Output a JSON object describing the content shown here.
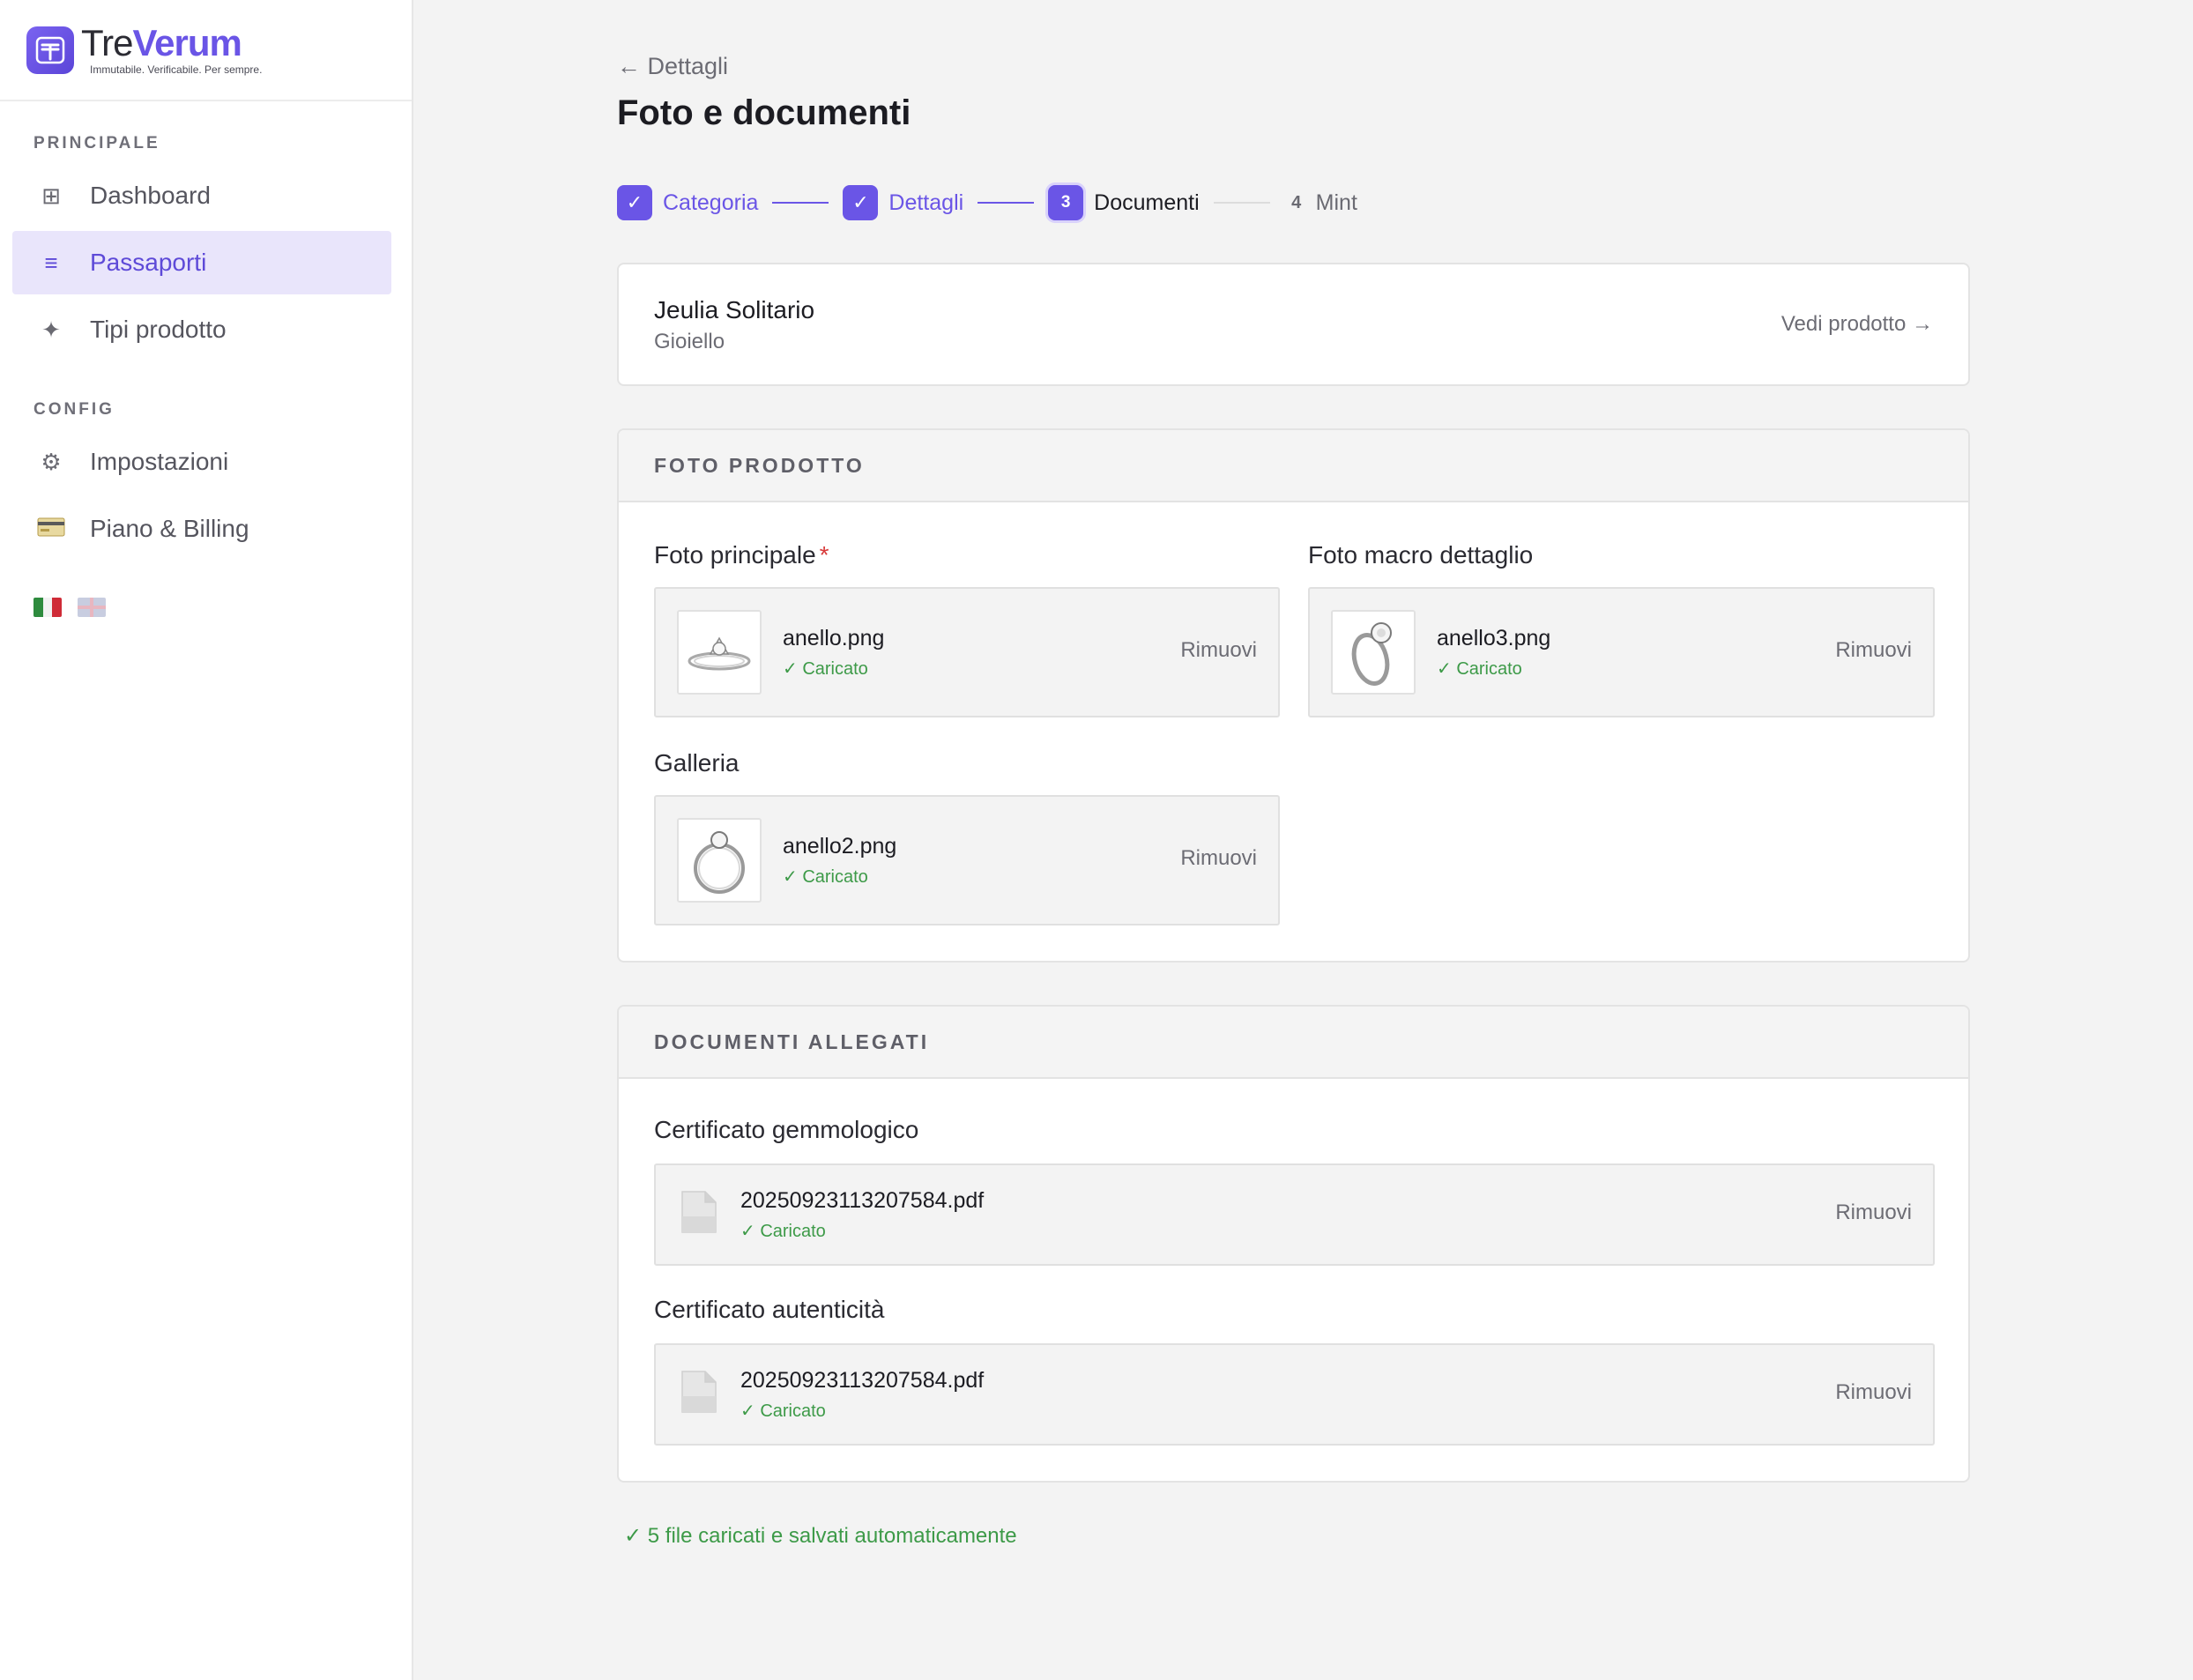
{
  "brand": {
    "name_part1": "Tre",
    "name_part2": "Verum",
    "tagline": "Immutabile. Verificabile. Per sempre.",
    "accent_color": "#6a55e6"
  },
  "sidebar": {
    "section_main": "PRINCIPALE",
    "section_config": "CONFIG",
    "items": [
      {
        "label": "Dashboard",
        "icon": "grid-icon",
        "active": false
      },
      {
        "label": "Passaporti",
        "icon": "list-icon",
        "active": true
      },
      {
        "label": "Tipi prodotto",
        "icon": "sparkle-icon",
        "active": false
      },
      {
        "label": "Impostazioni",
        "icon": "gear-icon",
        "active": false
      },
      {
        "label": "Piano & Billing",
        "icon": "credit-card-icon",
        "active": false
      }
    ],
    "languages": [
      "it-flag-icon",
      "uk-flag-icon"
    ]
  },
  "header": {
    "back_label": "← Dettagli",
    "title": "Foto e documenti"
  },
  "stepper": {
    "steps": [
      {
        "number": "1",
        "label": "Categoria",
        "state": "done"
      },
      {
        "number": "2",
        "label": "Dettagli",
        "state": "done"
      },
      {
        "number": "3",
        "label": "Documenti",
        "state": "current"
      },
      {
        "number": "4",
        "label": "Mint",
        "state": "pending"
      }
    ]
  },
  "product": {
    "name": "Jeulia Solitario",
    "type": "Gioiello",
    "link_label": "Vedi prodotto →"
  },
  "photos": {
    "section_title": "FOTO PRODOTTO",
    "main_label": "Foto principale",
    "required_mark": "*",
    "macro_label": "Foto macro dettaglio",
    "gallery_label": "Galleria",
    "main_file": {
      "name": "anello.png",
      "status": "✓ Caricato",
      "action": "Rimuovi"
    },
    "macro_file": {
      "name": "anello3.png",
      "status": "✓ Caricato",
      "action": "Rimuovi"
    },
    "gallery_file": {
      "name": "anello2.png",
      "status": "✓ Caricato",
      "action": "Rimuovi"
    }
  },
  "documents": {
    "section_title": "DOCUMENTI ALLEGATI",
    "gem_label": "Certificato gemmologico",
    "auth_label": "Certificato autenticità",
    "gem_file": {
      "name": "20250923113207584.pdf",
      "status": "✓ Caricato",
      "action": "Rimuovi"
    },
    "auth_file": {
      "name": "20250923113207584.pdf",
      "status": "✓ Caricato",
      "action": "Rimuovi"
    }
  },
  "footer": {
    "autosave": "✓ 5 file caricati e salvati automaticamente"
  },
  "colors": {
    "success": "#3d9a48",
    "required": "#d83a3a",
    "active_bg": "#e9e5fb"
  }
}
